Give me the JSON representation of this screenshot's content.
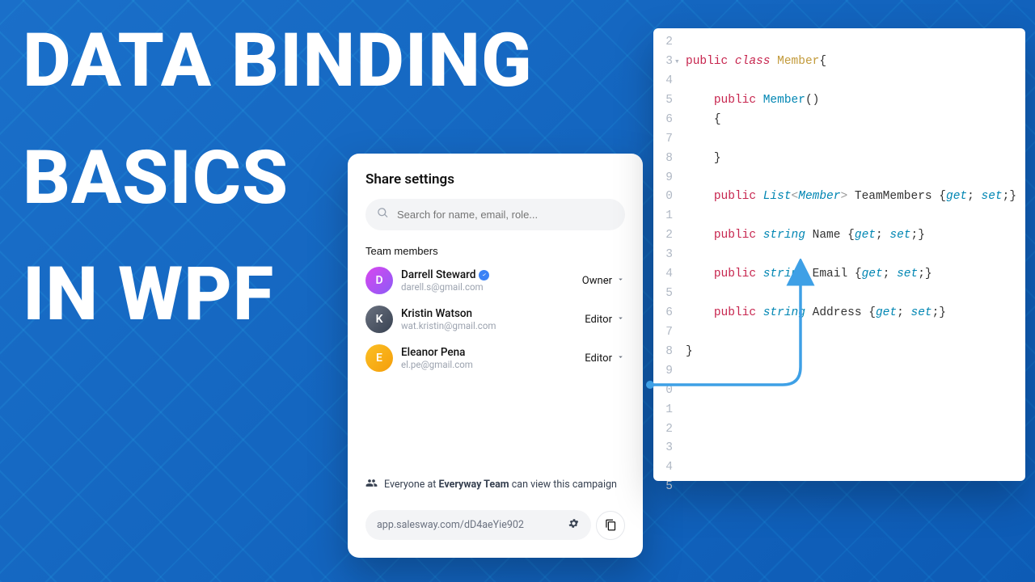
{
  "title": {
    "line1": "DATA BINDING",
    "line2": "BASICS",
    "line3": "IN WPF"
  },
  "share": {
    "heading": "Share settings",
    "search_placeholder": "Search for name, email, role...",
    "section_label": "Team members",
    "members": [
      {
        "name": "Darrell Steward",
        "email": "darell.s@gmail.com",
        "role": "Owner",
        "verified": true,
        "initial": "D"
      },
      {
        "name": "Kristin Watson",
        "email": "wat.kristin@gmail.com",
        "role": "Editor",
        "verified": false,
        "initial": "K"
      },
      {
        "name": "Eleanor Pena",
        "email": "el.pe@gmail.com",
        "role": "Editor",
        "verified": false,
        "initial": "E"
      }
    ],
    "everyone_prefix": "Everyone at ",
    "everyone_team": "Everyway Team",
    "everyone_suffix": " can view this campaign",
    "share_url": "app.salesway.com/dD4aeYie902"
  },
  "code": {
    "lines": [
      {
        "n": "2",
        "fold": "",
        "html": ""
      },
      {
        "n": "3",
        "fold": "▾",
        "html": "<span class='kw'>public</span> <span class='itkw'>class</span> <span class='cls'>Member</span><span class='p'>{</span>"
      },
      {
        "n": "4",
        "fold": "",
        "html": ""
      },
      {
        "n": "5",
        "fold": "",
        "html": "    <span class='kw'>public</span> <span class='ty'>Member</span><span class='p'>()</span>"
      },
      {
        "n": "6",
        "fold": "",
        "html": "    <span class='p'>{</span>"
      },
      {
        "n": "7",
        "fold": "",
        "html": ""
      },
      {
        "n": "8",
        "fold": "",
        "html": "    <span class='p'>}</span>"
      },
      {
        "n": "9",
        "fold": "",
        "html": ""
      },
      {
        "n": "0",
        "fold": "",
        "html": "    <span class='kw'>public</span> <span class='it'>List</span><span class='grey'>&lt;</span><span class='it'>Member</span><span class='grey'>&gt;</span> <span class='p'>TeamMembers {</span><span class='it'>get</span><span class='p'>; </span><span class='it'>set</span><span class='p'>;}</span>"
      },
      {
        "n": "1",
        "fold": "",
        "html": ""
      },
      {
        "n": "2",
        "fold": "",
        "html": "    <span class='kw'>public</span> <span class='it'>string</span> <span class='p'>Name {</span><span class='it'>get</span><span class='p'>; </span><span class='it'>set</span><span class='p'>;}</span>"
      },
      {
        "n": "3",
        "fold": "",
        "html": ""
      },
      {
        "n": "4",
        "fold": "",
        "html": "    <span class='kw'>public</span> <span class='it'>string</span> <span class='p'>Email {</span><span class='it'>get</span><span class='p'>; </span><span class='it'>set</span><span class='p'>;}</span>"
      },
      {
        "n": "5",
        "fold": "",
        "html": ""
      },
      {
        "n": "6",
        "fold": "",
        "html": "    <span class='kw'>public</span> <span class='it'>string</span> <span class='p'>Address {</span><span class='it'>get</span><span class='p'>; </span><span class='it'>set</span><span class='p'>;}</span>"
      },
      {
        "n": "7",
        "fold": "",
        "html": ""
      },
      {
        "n": "8",
        "fold": "",
        "html": "<span class='p'>}</span>"
      },
      {
        "n": "9",
        "fold": "",
        "html": ""
      },
      {
        "n": "0",
        "fold": "",
        "html": ""
      },
      {
        "n": "1",
        "fold": "",
        "html": ""
      },
      {
        "n": "2",
        "fold": "",
        "html": ""
      },
      {
        "n": "3",
        "fold": "",
        "html": ""
      },
      {
        "n": "4",
        "fold": "",
        "html": ""
      },
      {
        "n": "5",
        "fold": "",
        "html": ""
      }
    ]
  }
}
